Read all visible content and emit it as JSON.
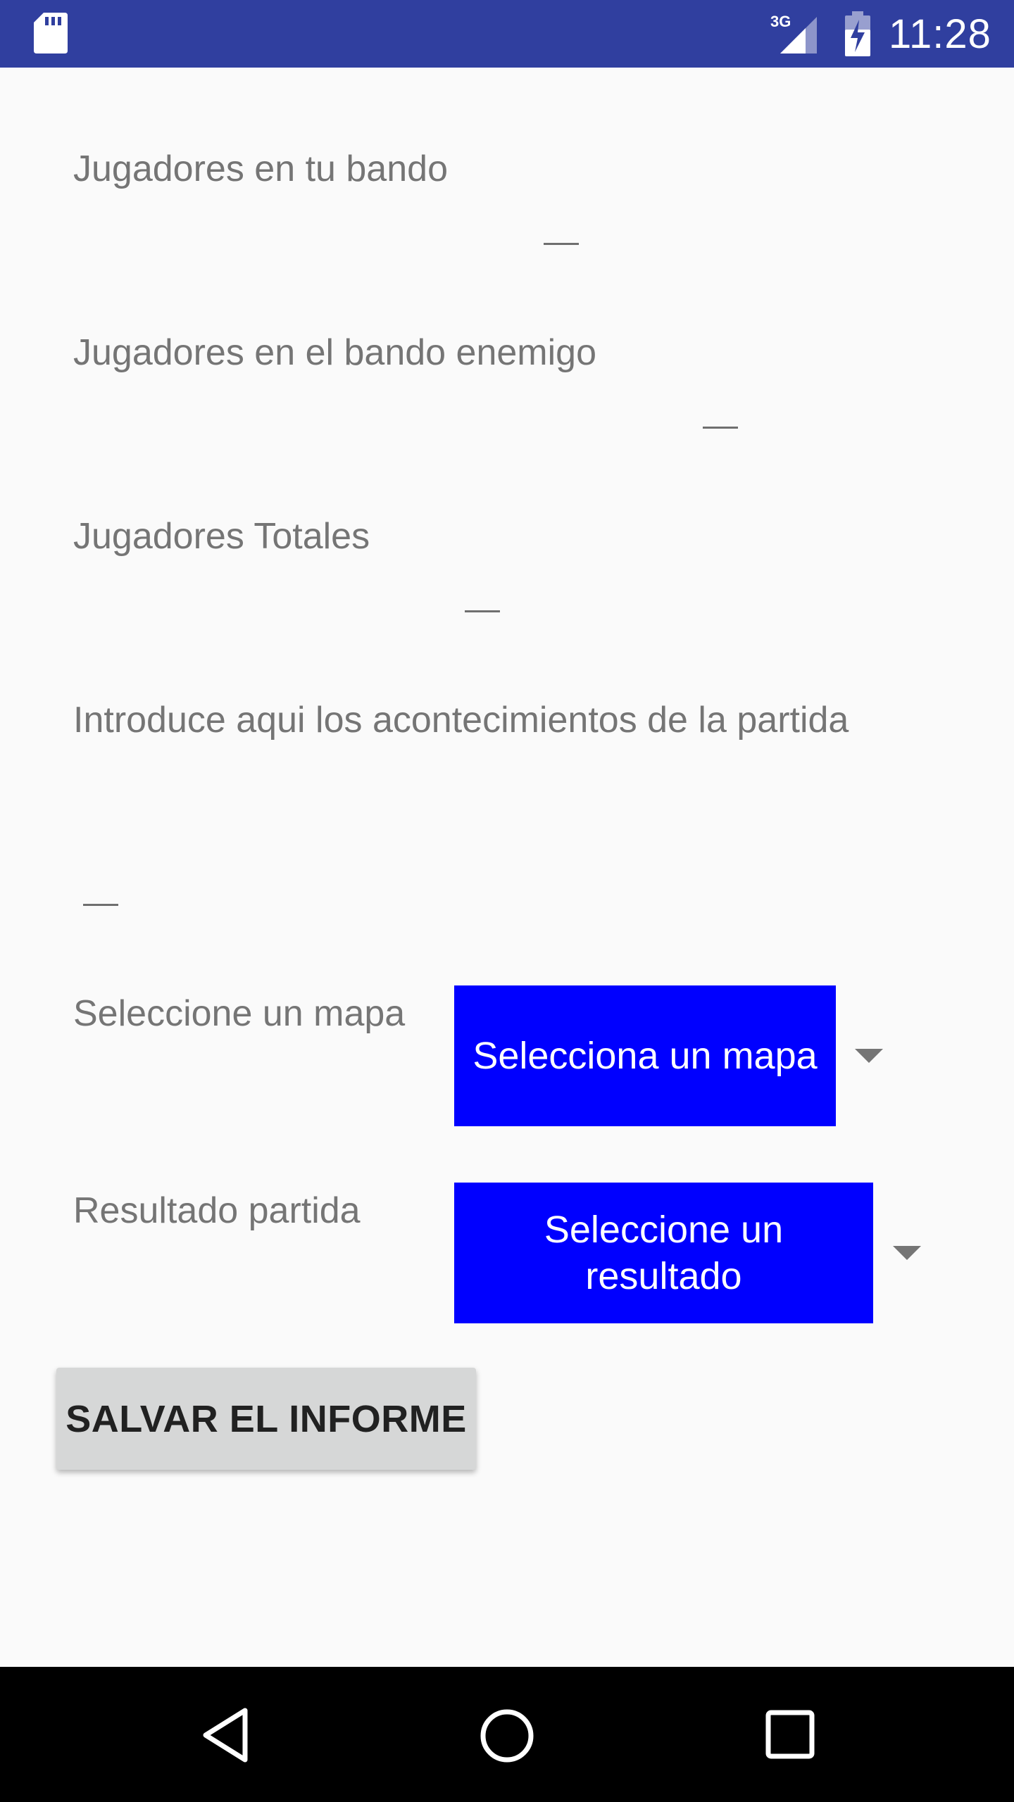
{
  "status_bar": {
    "time": "11:28",
    "network": "3G",
    "icons": [
      "sd-card-icon",
      "signal-3g-icon",
      "battery-charging-icon"
    ]
  },
  "form": {
    "players_your_side_label": "Jugadores en tu bando",
    "players_enemy_side_label": "Jugadores en el bando enemigo",
    "players_total_label": "Jugadores Totales",
    "events_label": "Introduce aqui los acontecimientos de la partida",
    "map_label": "Seleccione un mapa",
    "map_spinner_value": "Selecciona un mapa",
    "result_label": "Resultado partida",
    "result_spinner_value": "Seleccione un resultado",
    "save_button": "SALVAR EL INFORME"
  },
  "nav_bar": {
    "icons": [
      "back-icon",
      "home-icon",
      "recents-icon"
    ]
  },
  "colors": {
    "status_bar": "#303f9f",
    "spinner_background": "#0000ff",
    "background": "#fafafa",
    "button_background": "#d6d7d7"
  }
}
